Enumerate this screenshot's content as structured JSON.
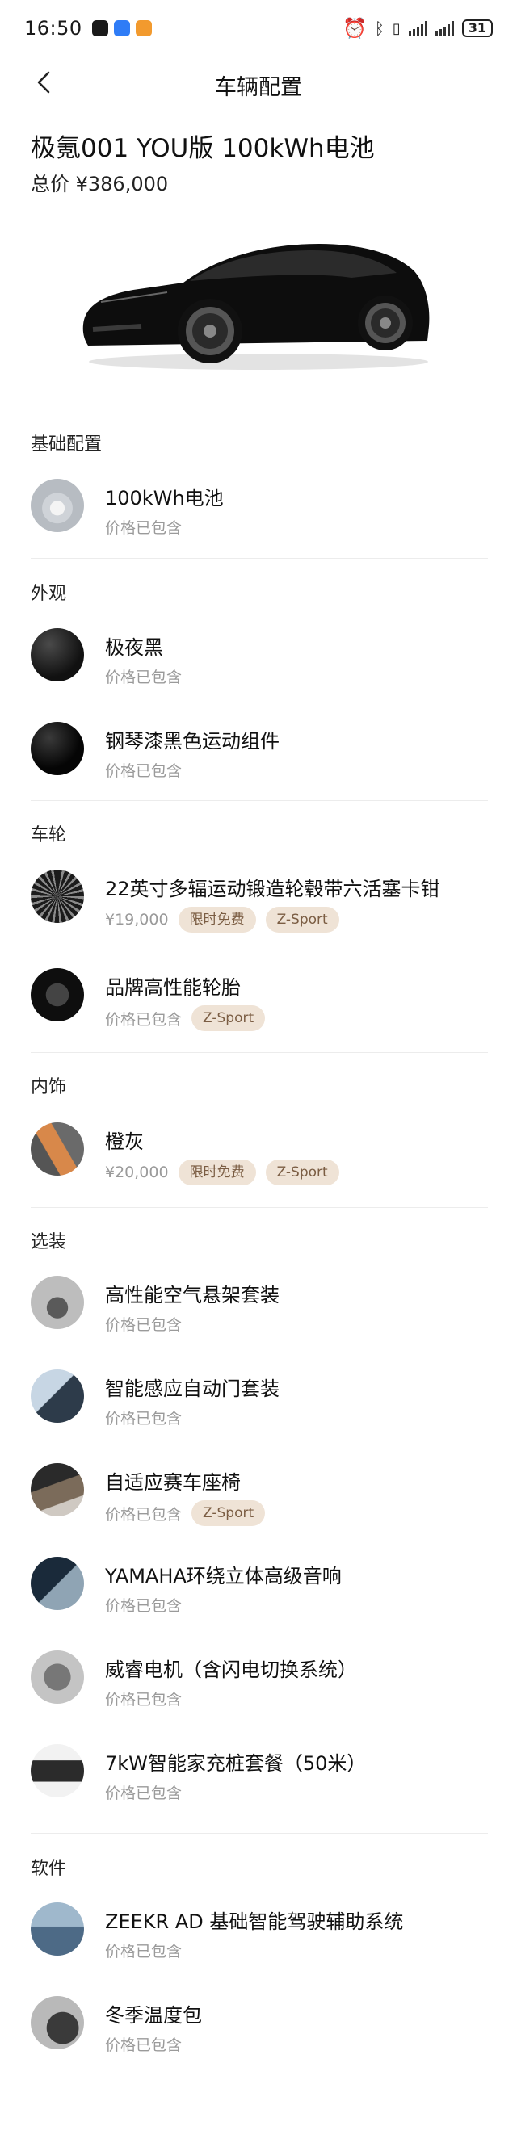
{
  "status_bar": {
    "time": "16:50",
    "battery": "31"
  },
  "nav": {
    "title": "车辆配置"
  },
  "car": {
    "name": "极氪001 YOU版 100kWh电池",
    "total_price": "总价 ¥386,000"
  },
  "sections": [
    {
      "title": "基础配置",
      "items": [
        {
          "name": "100kWh电池",
          "price": "价格已包含",
          "tags": []
        }
      ]
    },
    {
      "title": "外观",
      "items": [
        {
          "name": "极夜黑",
          "price": "价格已包含",
          "tags": []
        },
        {
          "name": "钢琴漆黑色运动组件",
          "price": "价格已包含",
          "tags": []
        }
      ]
    },
    {
      "title": "车轮",
      "items": [
        {
          "name": "22英寸多辐运动锻造轮毂带六活塞卡钳",
          "price": "¥19,000",
          "tags": [
            "限时免费",
            "Z-Sport"
          ]
        },
        {
          "name": "品牌高性能轮胎",
          "price": "价格已包含",
          "tags": [
            "Z-Sport"
          ]
        }
      ]
    },
    {
      "title": "内饰",
      "items": [
        {
          "name": "橙灰",
          "price": "¥20,000",
          "tags": [
            "限时免费",
            "Z-Sport"
          ]
        }
      ]
    },
    {
      "title": "选装",
      "items": [
        {
          "name": "高性能空气悬架套装",
          "price": "价格已包含",
          "tags": []
        },
        {
          "name": "智能感应自动门套装",
          "price": "价格已包含",
          "tags": []
        },
        {
          "name": "自适应赛车座椅",
          "price": "价格已包含",
          "tags": [
            "Z-Sport"
          ]
        },
        {
          "name": "YAMAHA环绕立体高级音响",
          "price": "价格已包含",
          "tags": []
        },
        {
          "name": "威睿电机（含闪电切换系统）",
          "price": "价格已包含",
          "tags": []
        },
        {
          "name": "7kW智能家充桩套餐（50米）",
          "price": "价格已包含",
          "tags": []
        }
      ]
    },
    {
      "title": "软件",
      "items": [
        {
          "name": "ZEEKR AD 基础智能驾驶辅助系统",
          "price": "价格已包含",
          "tags": []
        },
        {
          "name": "冬季温度包",
          "price": "价格已包含",
          "tags": []
        }
      ]
    }
  ],
  "colors": {
    "tag_bg": "#efe3d6",
    "tag_text": "#7b5d43",
    "muted": "#9a9a9a"
  }
}
